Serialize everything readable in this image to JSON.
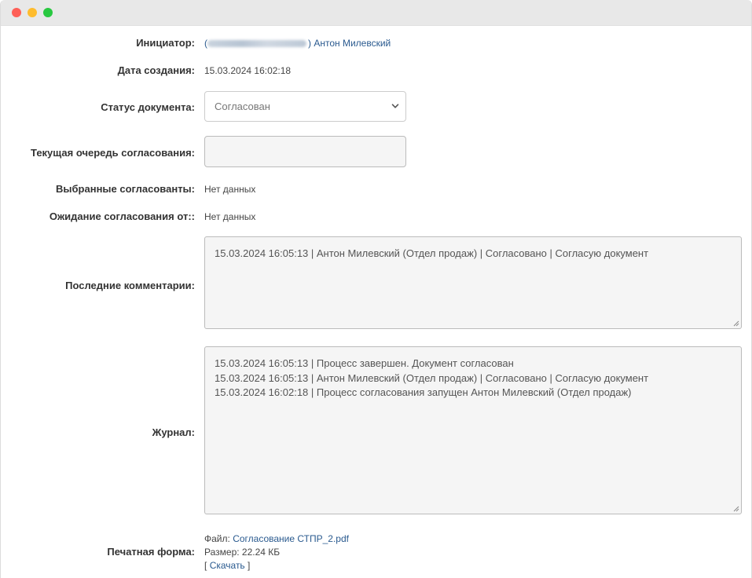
{
  "window": {
    "controls": [
      "close",
      "minimize",
      "maximize"
    ]
  },
  "initiator": {
    "label": "Инициатор:",
    "name": "Антон Милевский",
    "prefix": "(",
    "suffix": ")"
  },
  "created": {
    "label": "Дата создания:",
    "value": "15.03.2024 16:02:18"
  },
  "status": {
    "label": "Статус документа:",
    "selected": "Согласован"
  },
  "queue": {
    "label": "Текущая очередь согласования:",
    "value": ""
  },
  "approvers": {
    "label": "Выбранные согласованты:",
    "value": "Нет данных"
  },
  "waiting": {
    "label": "Ожидание согласования от::",
    "value": "Нет данных"
  },
  "comments": {
    "label": "Последние комментарии:",
    "lines": [
      "15.03.2024 16:05:13 | Антон Милевский (Отдел продаж) | Согласовано | Согласую документ"
    ]
  },
  "journal": {
    "label": "Журнал:",
    "lines": [
      "15.03.2024 16:05:13 | Процесс завершен. Документ согласован",
      "15.03.2024 16:05:13 | Антон Милевский (Отдел продаж) | Согласовано | Согласую документ",
      "15.03.2024 16:02:18 | Процесс согласования запущен Антон Милевский (Отдел продаж)"
    ]
  },
  "print_form": {
    "label": "Печатная форма:",
    "file_label": "Файл:",
    "file_name": "Согласование СТПР_2.pdf",
    "size_text": "Размер: 22.24 КБ",
    "bracket_open": "[",
    "download_label": "Скачать",
    "bracket_close": "]"
  }
}
